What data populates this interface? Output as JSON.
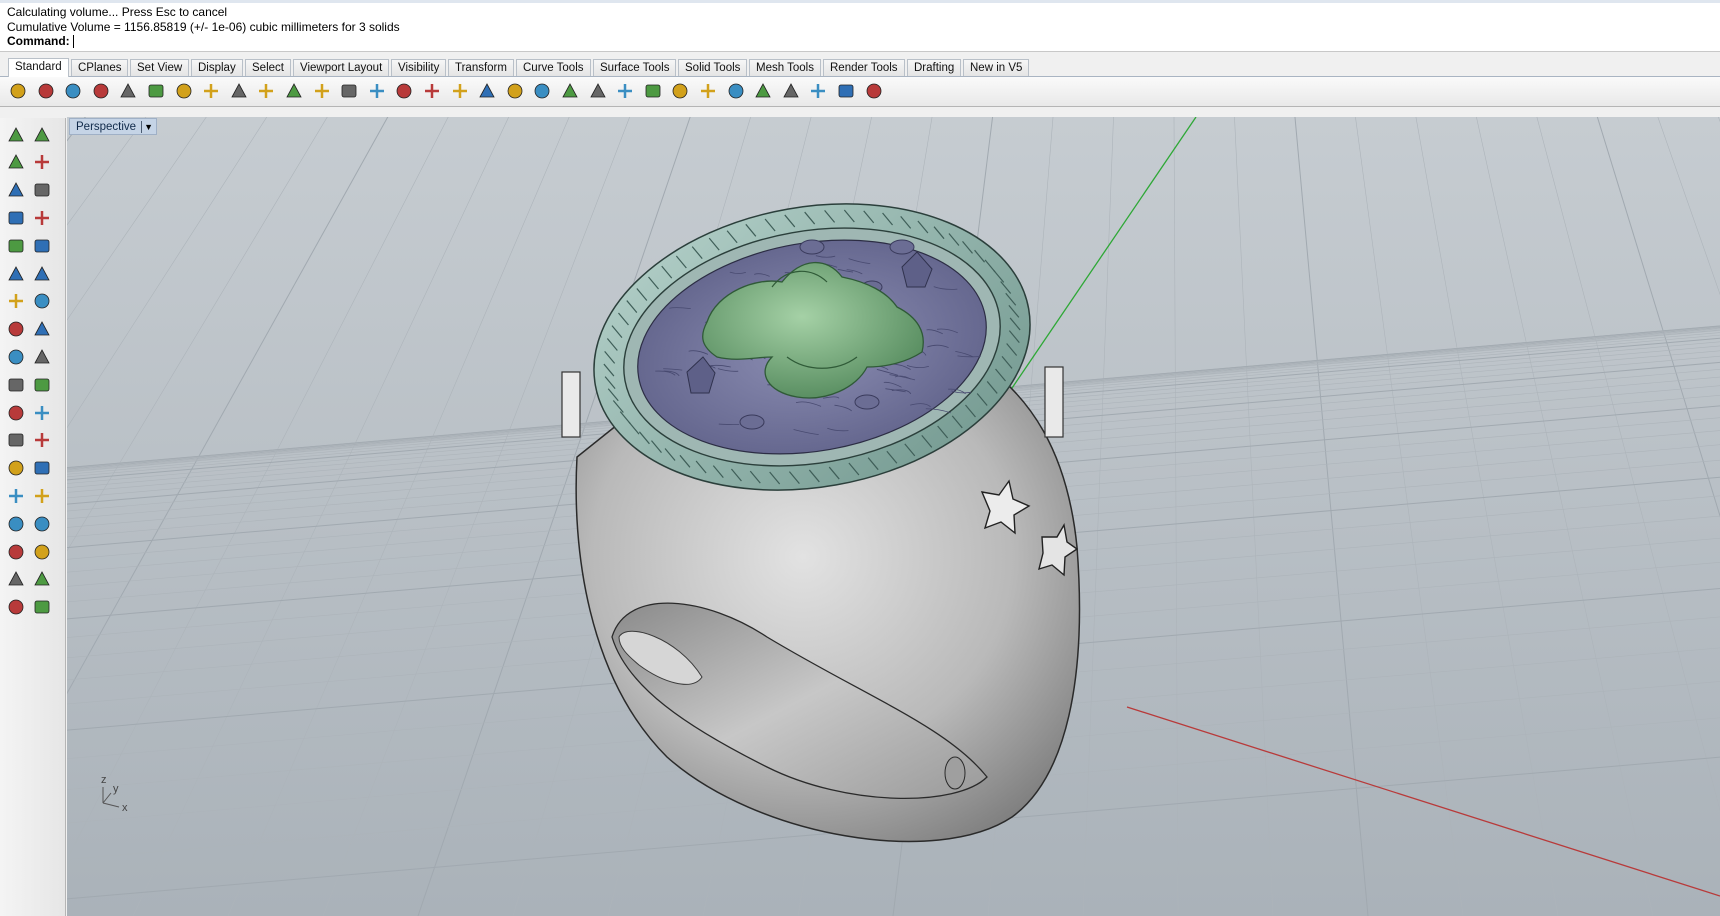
{
  "command_area": {
    "line1": "Calculating volume... Press Esc to cancel",
    "line2": "Cumulative Volume = 1156.85819 (+/- 1e-06) cubic millimeters for 3 solids",
    "prompt": "Command:"
  },
  "tabs": [
    {
      "label": "Standard",
      "active": true
    },
    {
      "label": "CPlanes"
    },
    {
      "label": "Set View"
    },
    {
      "label": "Display"
    },
    {
      "label": "Select"
    },
    {
      "label": "Viewport Layout"
    },
    {
      "label": "Visibility"
    },
    {
      "label": "Transform"
    },
    {
      "label": "Curve Tools"
    },
    {
      "label": "Surface Tools"
    },
    {
      "label": "Solid Tools"
    },
    {
      "label": "Mesh Tools"
    },
    {
      "label": "Render Tools"
    },
    {
      "label": "Drafting"
    },
    {
      "label": "New in V5"
    }
  ],
  "toolbar_icons": [
    "new-file-icon",
    "open-folder-icon",
    "save-icon",
    "print-icon",
    "copy-file-icon",
    "cut-icon",
    "copy-icon",
    "paste-icon",
    "undo-icon",
    "pan-hand-icon",
    "move-cross-icon",
    "zoom-icon",
    "zoom-window-icon",
    "zoom-extents-icon",
    "zoom-selected-icon",
    "rotate-view-icon",
    "four-views-icon",
    "car-icon",
    "eye-icon",
    "cplane-icon",
    "point-icon",
    "light-bulb-icon",
    "lock-icon",
    "render-mode-icon",
    "color-wheel-icon",
    "shaded-sphere-icon",
    "rendered-sphere-icon",
    "blue-sphere-icon",
    "flag-icon",
    "gear-icon",
    "dimension-icon",
    "help-icon"
  ],
  "left_toolbar_icons": [
    "select-arrow-icon",
    "point-icon",
    "polyline-icon",
    "curve-icon",
    "circle-icon",
    "ellipse-icon",
    "polygon-icon",
    "rectangle-icon",
    "circle-center-icon",
    "arc-icon",
    "transform-icon",
    "surface-patch-icon",
    "box-icon",
    "sphere-icon",
    "extrude-icon",
    "plane-surface-icon",
    "explode-icon",
    "boolean-icon",
    "split-icon",
    "trim-icon",
    "solid-union-icon",
    "solid-diff-icon",
    "fillet-icon",
    "offset-icon",
    "text-icon",
    "dimension-icon",
    "group-icon",
    "properties-icon",
    "block-icon",
    "layer-icon",
    "array-icon",
    "align-icon",
    "analyze-icon",
    "check-icon",
    "mesh-icon",
    "render-icon"
  ],
  "viewport": {
    "title": "Perspective",
    "axis_y": "y",
    "axis_x": "x",
    "axis_z": "z"
  }
}
